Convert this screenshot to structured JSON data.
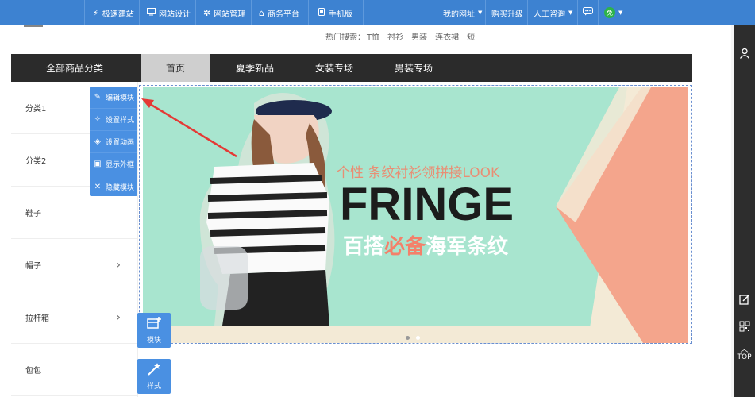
{
  "topbar": {
    "items": [
      {
        "icon": "lightning-icon",
        "label": "极速建站"
      },
      {
        "icon": "monitor-icon",
        "label": "网站设计"
      },
      {
        "icon": "gear-icon",
        "label": "网站管理"
      },
      {
        "icon": "home-icon",
        "label": "商务平台"
      },
      {
        "icon": "phone-icon",
        "label": "手机版"
      }
    ],
    "right": {
      "my_site": "我的网址",
      "buy": "购买升级",
      "consult": "人工咨询",
      "avatar_text": "免"
    }
  },
  "hot_search": {
    "label": "热门搜索：",
    "terms": [
      "T恤",
      "衬衫",
      "男装",
      "连衣裙",
      "短"
    ]
  },
  "nav": {
    "items": [
      "全部商品分类",
      "首页",
      "夏季新品",
      "女装专场",
      "男装专场"
    ],
    "active": "首页"
  },
  "sidebar": {
    "categories": [
      {
        "label": "分类1",
        "has_arrow": false
      },
      {
        "label": "分类2",
        "has_arrow": false
      },
      {
        "label": "鞋子",
        "has_arrow": false
      },
      {
        "label": "帽子",
        "has_arrow": true
      },
      {
        "label": "拉杆箱",
        "has_arrow": true
      },
      {
        "label": "包包",
        "has_arrow": false
      }
    ]
  },
  "tool_panel": {
    "items": [
      {
        "icon": "pencil-icon",
        "label": "编辑模块"
      },
      {
        "icon": "style-icon",
        "label": "设置样式"
      },
      {
        "icon": "animation-icon",
        "label": "设置动画"
      },
      {
        "icon": "frame-icon",
        "label": "显示外框"
      },
      {
        "icon": "close-icon",
        "label": "隐藏模块"
      }
    ]
  },
  "banner": {
    "subtitle": "个性 条纹衬衫领拼接LOOK",
    "title": "FRINGE",
    "slogan_a": "百搭",
    "slogan_b": "必备",
    "slogan_c": "海军条纹",
    "colors": {
      "bg": "#a8e5cf",
      "accent": "#f4917a",
      "cream": "#f3ead6"
    }
  },
  "float_buttons": [
    {
      "icon": "module-icon",
      "label": "模块"
    },
    {
      "icon": "magic-wand-icon",
      "label": "样式"
    }
  ],
  "right_bar": {
    "top_label": "TOP"
  }
}
